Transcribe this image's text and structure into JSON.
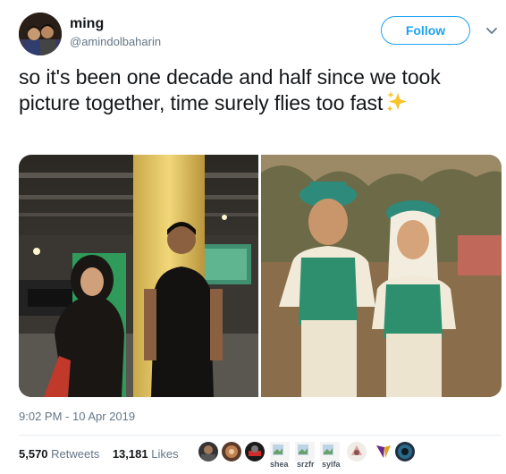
{
  "user": {
    "display_name": "ming",
    "handle": "@amindolbaharin",
    "follow_label": "Follow"
  },
  "tweet": {
    "text": "so it's been one decade and half since we took picture together, time surely flies too fast",
    "emoji": "sparkles-emoji",
    "timestamp": "9:02 PM - 10 Apr 2019"
  },
  "stats": {
    "retweets_count": "5,570",
    "retweets_label": "Retweets",
    "likes_count": "13,181",
    "likes_label": "Likes"
  },
  "likers": [
    {
      "name": ""
    },
    {
      "name": ""
    },
    {
      "name": ""
    },
    {
      "name": "shea"
    },
    {
      "name": "srzfr"
    },
    {
      "name": "syifa"
    },
    {
      "name": ""
    },
    {
      "name": ""
    },
    {
      "name": ""
    }
  ],
  "colors": {
    "accent": "#1da1f2",
    "text_primary": "#14171a",
    "text_secondary": "#657786"
  }
}
